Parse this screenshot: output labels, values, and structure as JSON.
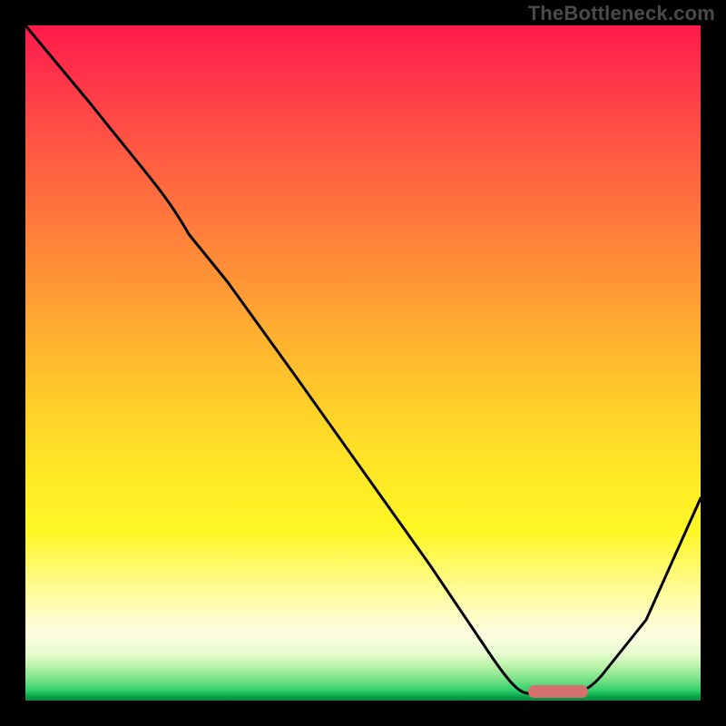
{
  "watermark": "TheBottleneck.com",
  "colors": {
    "frame": "#000000",
    "curve": "#000000",
    "marker": "#d6706f",
    "gradient_top": "#ff1a4b",
    "gradient_mid": "#ffe926",
    "gradient_bottom": "#078a3f"
  },
  "chart_data": {
    "type": "line",
    "title": "",
    "xlabel": "",
    "ylabel": "",
    "xlim": [
      0,
      100
    ],
    "ylim": [
      0,
      100
    ],
    "grid": false,
    "legend": false,
    "series": [
      {
        "name": "bottleneck-curve",
        "x": [
          0,
          10,
          22,
          30,
          40,
          50,
          60,
          68,
          74,
          80,
          86,
          92,
          100
        ],
        "y": [
          100,
          88,
          74,
          62,
          48,
          34,
          20,
          8,
          1,
          0,
          2,
          12,
          30
        ]
      }
    ],
    "marker": {
      "x_start": 74,
      "x_end": 83,
      "y": 0.8
    },
    "notes": "y = 0 is the green baseline (no bottleneck); y increases upward toward red (high bottleneck). Values estimated from the unlabeled gradient chart."
  }
}
